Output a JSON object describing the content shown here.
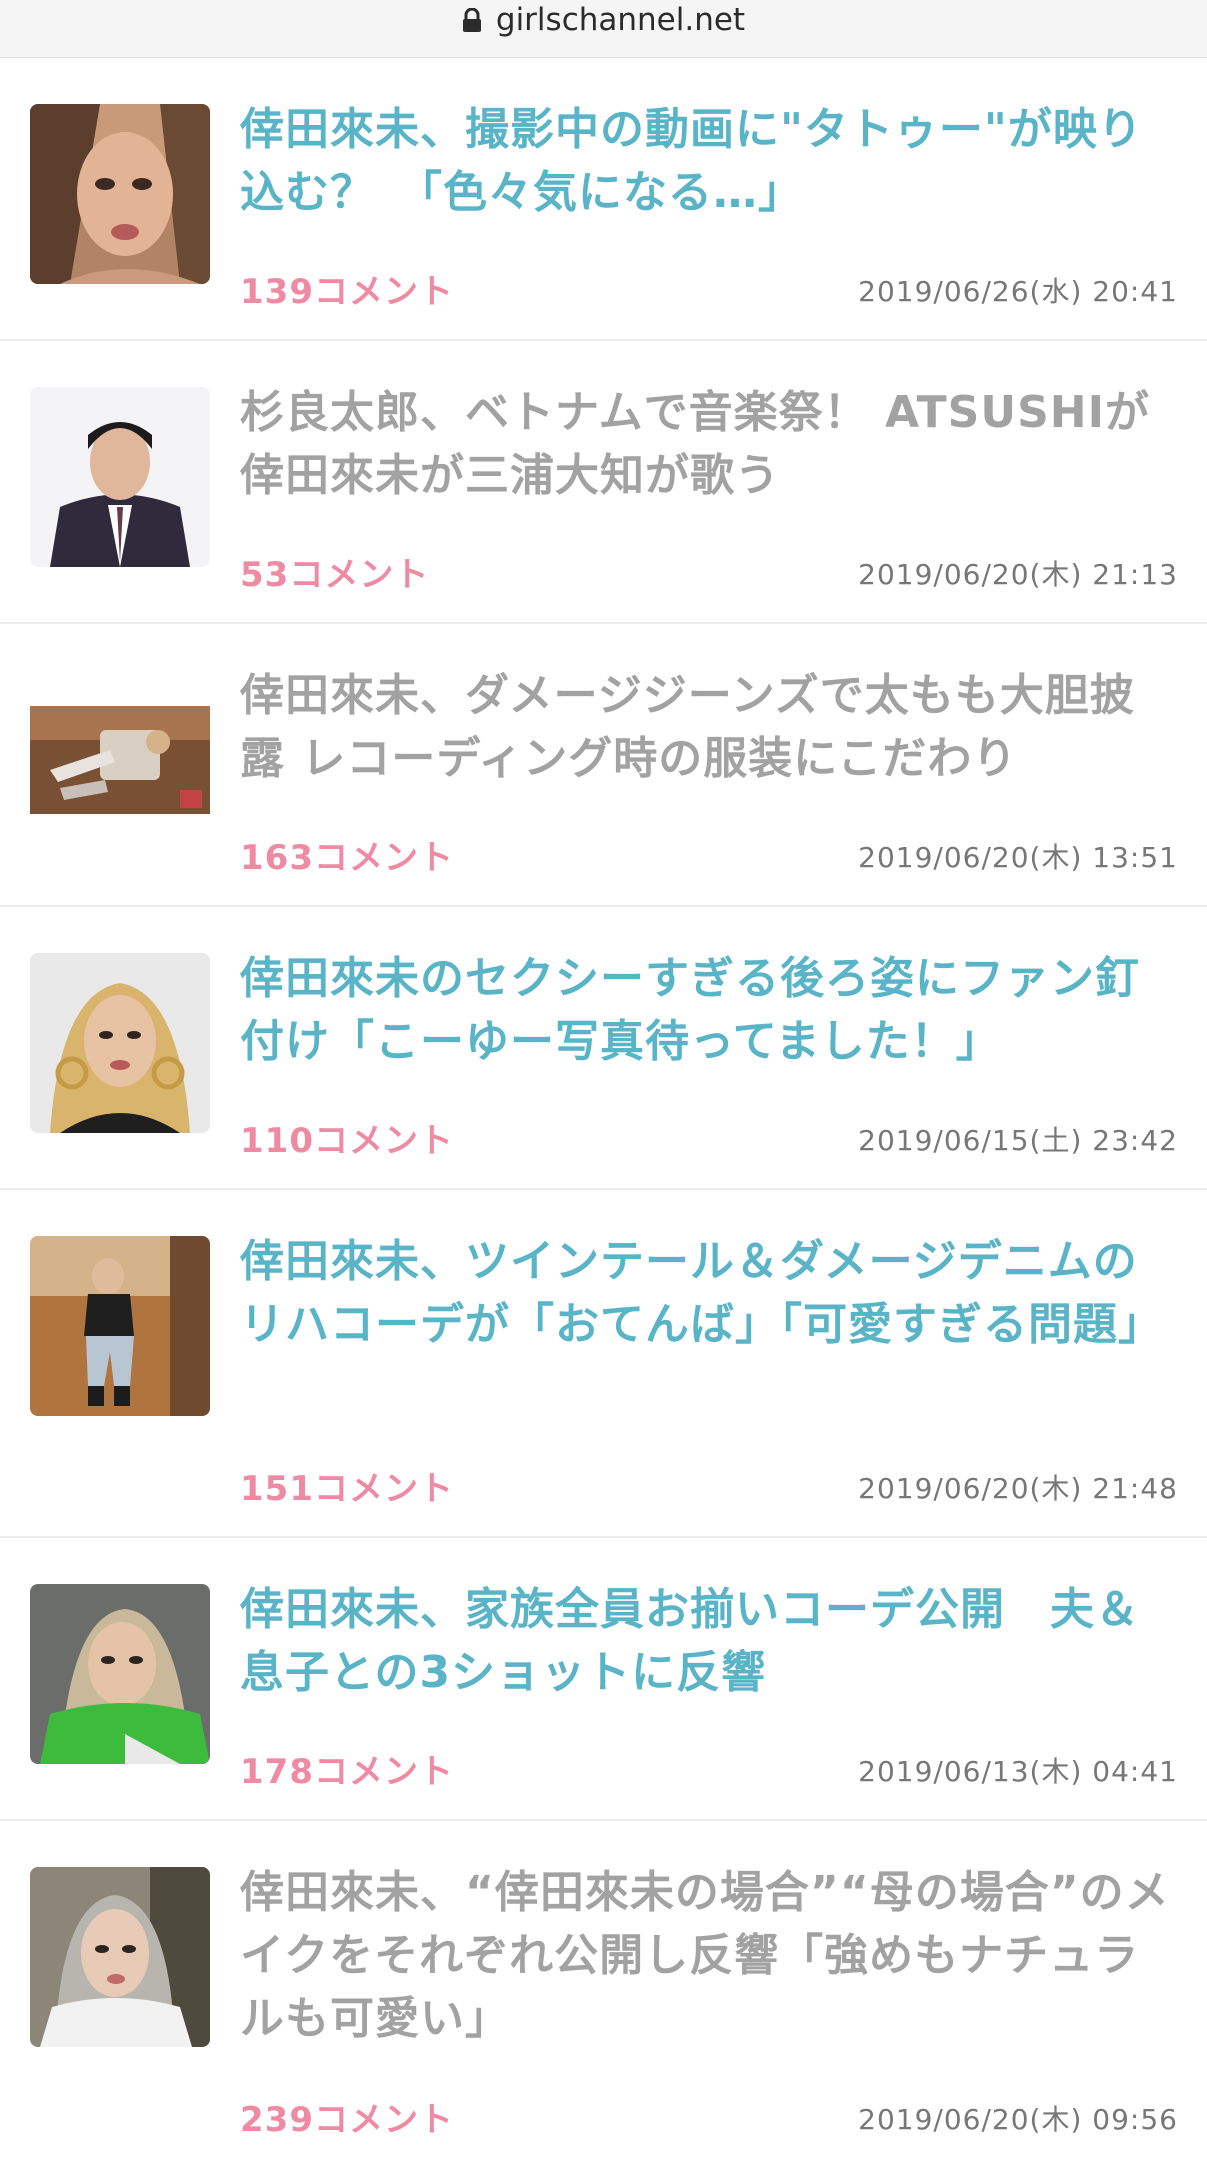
{
  "browser": {
    "url": "girlschannel.net",
    "lock_icon": "lock-icon"
  },
  "colors": {
    "title_link": "#5ab4c7",
    "title_visited": "#a2a2a2",
    "comments": "#ef8aa4",
    "date": "#777777"
  },
  "articles": [
    {
      "title": "倖田來未、撮影中の動画に\"タトゥー\"が映り込む？　「色々気になる…」",
      "comments": "139コメント",
      "date": "2019/06/26(水) 20:41",
      "visited": false
    },
    {
      "title": "杉良太郎、ベトナムで音楽祭！ ATSUSHIが倖田來未が三浦大知が歌う",
      "comments": "53コメント",
      "date": "2019/06/20(木) 21:13",
      "visited": true
    },
    {
      "title": "倖田來未、ダメージジーンズで太もも大胆披露 レコーディング時の服装にこだわり",
      "comments": "163コメント",
      "date": "2019/06/20(木) 13:51",
      "visited": true
    },
    {
      "title": "倖田來未のセクシーすぎる後ろ姿にファン釘付け「こーゆー写真待ってました！」",
      "comments": "110コメント",
      "date": "2019/06/15(土) 23:42",
      "visited": false
    },
    {
      "title": "倖田來未、ツインテール＆ダメージデニムのリハコーデが「おてんば」「可愛すぎる問題」",
      "comments": "151コメント",
      "date": "2019/06/20(木) 21:48",
      "visited": false
    },
    {
      "title": "倖田來未、家族全員お揃いコーデ公開　夫＆息子との3ショットに反響",
      "comments": "178コメント",
      "date": "2019/06/13(木) 04:41",
      "visited": false
    },
    {
      "title": "倖田來未、“倖田來未の場合”“母の場合”のメイクをそれぞれ公開し反響「強めもナチュラルも可愛い」",
      "comments": "239コメント",
      "date": "2019/06/20(木) 09:56",
      "visited": true
    }
  ]
}
